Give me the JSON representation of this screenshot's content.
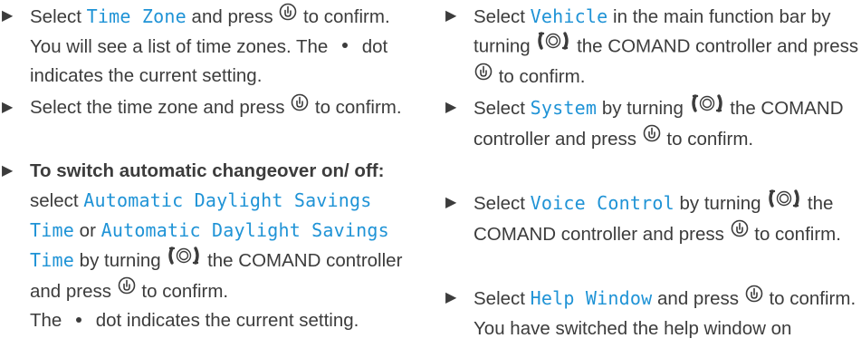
{
  "left": {
    "step1": {
      "t1": "Select ",
      "hl": "Time Zone",
      "t2": " and press ",
      "t3": " to confirm.",
      "t4": "You will see a list of time zones. The ",
      "t5": " dot indicates the current setting."
    },
    "step2": {
      "t1": "Select the time zone and press ",
      "t2": " to confirm."
    },
    "step3": {
      "bold": "To switch automatic changeover on/ off:",
      "t1": " select ",
      "hl1": "Automatic Daylight Savings Time",
      "t2": " or ",
      "hl2": "Automatic Daylight Savings Time",
      "t3": " by turning ",
      "t4": " the COMAND controller and press ",
      "t5": " to confirm.",
      "t6": "The ",
      "t7": " dot indicates the current setting."
    }
  },
  "right": {
    "step1": {
      "t1": "Select ",
      "hl": "Vehicle",
      "t2": " in the main function bar by turning ",
      "t3": " the COMAND controller and press ",
      "t4": " to confirm."
    },
    "step2": {
      "t1": "Select ",
      "hl": "System",
      "t2": " by turning ",
      "t3": " the COMAND controller and press ",
      "t4": " to confirm."
    },
    "step3": {
      "t1": "Select ",
      "hl": "Voice Control",
      "t2": " by turning ",
      "t3": " the COMAND controller and press ",
      "t4": " to confirm."
    },
    "step4": {
      "t1": "Select ",
      "hl": "Help Window",
      "t2": " and press ",
      "t3": " to confirm.",
      "t4": "You have switched the help window on"
    }
  },
  "colors": {
    "text": "#3c3c3c",
    "highlight": "#1f93d6"
  },
  "icons": [
    "step-arrow-icon",
    "press-controller-icon",
    "turn-controller-icon",
    "current-setting-dot-icon"
  ]
}
